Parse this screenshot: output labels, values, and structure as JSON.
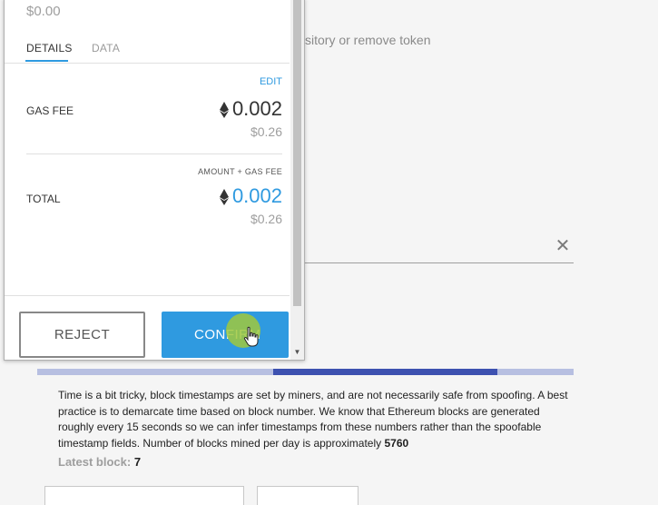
{
  "background": {
    "hint_text": "sitory or remove token",
    "clear_icon": "close-icon",
    "description_prefix": "Time is a bit tricky, block timestamps are set by miners, and are not necessarily safe from spoofing. A best practice is to demarcate time based on block number. We know that Ethereum blocks are generated roughly every 15 seconds so we can infer timestamps from these numbers rather than the spoofable timestamp fields. Number of blocks mined per day is approximately",
    "blocks_per_day": "5760",
    "latest_label": "Latest block:",
    "latest_value": "7",
    "progress": {
      "start_fraction": 0.44,
      "end_fraction": 0.858
    },
    "colors": {
      "progress_track": "#b7bfe1",
      "progress_fill": "#3d51b0"
    }
  },
  "popup": {
    "amount_usd": "$0.00",
    "tabs": [
      {
        "label": "DETAILS",
        "active": true
      },
      {
        "label": "DATA",
        "active": false
      }
    ],
    "edit_label": "EDIT",
    "gas_fee": {
      "label": "GAS FEE",
      "eth": "0.002",
      "usd": "$0.26"
    },
    "total": {
      "sub_label": "AMOUNT + GAS FEE",
      "label": "TOTAL",
      "eth": "0.002",
      "usd": "$0.26"
    },
    "buttons": {
      "reject": "REJECT",
      "confirm": "CONFIRM"
    },
    "colors": {
      "accent": "#2f9ae0"
    }
  }
}
